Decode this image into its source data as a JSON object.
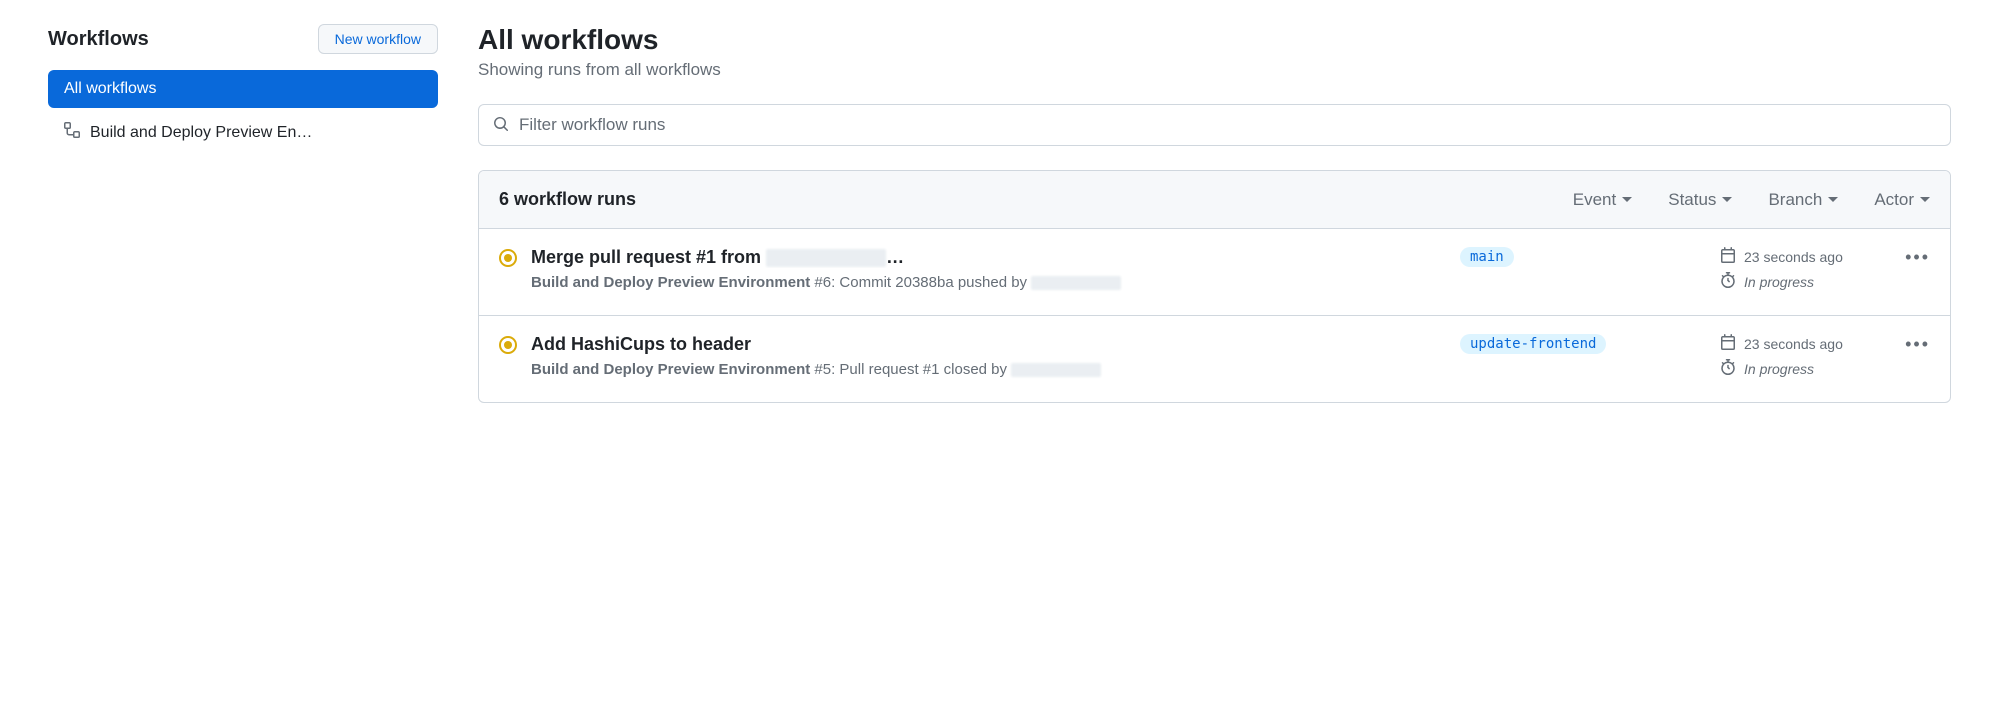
{
  "sidebar": {
    "title": "Workflows",
    "new_button": "New workflow",
    "items": [
      {
        "label": "All workflows",
        "active": true
      },
      {
        "label": "Build and Deploy Preview En…",
        "active": false
      }
    ]
  },
  "main": {
    "title": "All workflows",
    "subtitle": "Showing runs from all workflows",
    "search": {
      "placeholder": "Filter workflow runs"
    },
    "runs_count": "6 workflow runs",
    "filters": {
      "event": "Event",
      "status": "Status",
      "branch": "Branch",
      "actor": "Actor"
    },
    "runs": [
      {
        "title_prefix": "Merge pull request #1 from ",
        "title_suffix": "…",
        "workflow_name": "Build and Deploy Preview Environment",
        "run_number": "#6",
        "desc_tail": ": Commit 20388ba pushed by ",
        "branch": "main",
        "timestamp": "23 seconds ago",
        "status": "In progress"
      },
      {
        "title_prefix": "Add HashiCups to header",
        "title_suffix": "",
        "workflow_name": "Build and Deploy Preview Environment",
        "run_number": "#5",
        "desc_tail": ": Pull request #1 closed by ",
        "branch": "update-frontend",
        "timestamp": "23 seconds ago",
        "status": "In progress"
      }
    ]
  }
}
